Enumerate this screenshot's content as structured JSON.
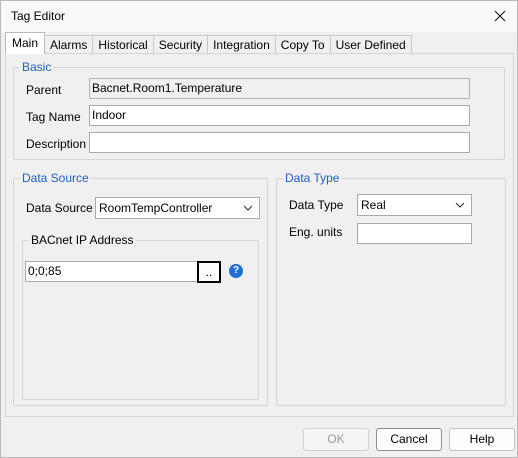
{
  "window": {
    "title": "Tag Editor"
  },
  "tabs": [
    "Main",
    "Alarms",
    "Historical",
    "Security",
    "Integration",
    "Copy To",
    "User Defined"
  ],
  "basic": {
    "legend": "Basic",
    "parent_label": "Parent",
    "parent_value": "Bacnet.Room1.Temperature",
    "tag_name_label": "Tag Name",
    "tag_name_value": "Indoor",
    "description_label": "Description",
    "description_value": ""
  },
  "data_source": {
    "legend": "Data Source",
    "label": "Data Source",
    "selected": "RoomTempController",
    "bacnet_legend": "BACnet IP Address",
    "address_value": "0;0;85",
    "browse_label": ".."
  },
  "data_type": {
    "legend": "Data Type",
    "label": "Data Type",
    "selected": "Real",
    "units_label": "Eng. units",
    "units_value": ""
  },
  "buttons": {
    "ok": "OK",
    "cancel": "Cancel",
    "help": "Help"
  },
  "icons": {
    "close": "close-icon",
    "dropdown": "chevron-down-icon",
    "help": "help-icon"
  },
  "colors": {
    "group_legend": "#1f5fbf",
    "help_icon": "#1e70d8"
  }
}
